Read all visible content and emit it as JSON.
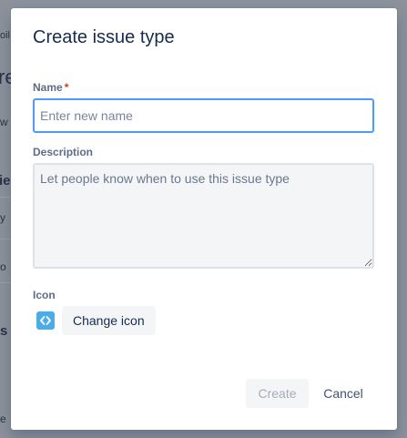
{
  "background": {
    "fragments": [
      "oil",
      "re",
      "w",
      "ie",
      "y",
      "o",
      "s",
      "e"
    ]
  },
  "dialog": {
    "title": "Create issue type",
    "name_field": {
      "label": "Name",
      "required_marker": "*",
      "placeholder": "Enter new name",
      "value": ""
    },
    "description_field": {
      "label": "Description",
      "placeholder": "Let people know when to use this issue type",
      "value": ""
    },
    "icon_field": {
      "label": "Icon",
      "icon_name": "code-icon",
      "icon_color": "#4bade8",
      "change_label": "Change icon"
    },
    "actions": {
      "create_label": "Create",
      "create_enabled": false,
      "cancel_label": "Cancel"
    }
  },
  "colors": {
    "title": "#172b4d",
    "focus_border": "#4c9aff",
    "required": "#de350b",
    "disabled_text": "#a5adba",
    "overlay": "#8c929c"
  }
}
